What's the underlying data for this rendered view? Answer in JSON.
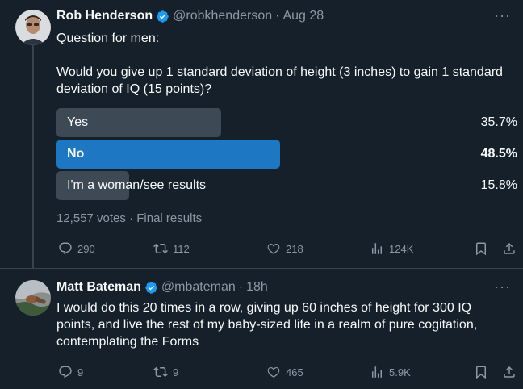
{
  "tweets": [
    {
      "display_name": "Rob Henderson",
      "handle": "@robkhenderson",
      "separator": "·",
      "time": "Aug 28",
      "text": "Question for men:\n\nWould you give up 1 standard deviation of height (3 inches) to gain 1 standard deviation of IQ (15 points)?",
      "poll": {
        "options": [
          {
            "label": "Yes",
            "percent": "35.7%",
            "fraction": 0.357,
            "winner": false
          },
          {
            "label": "No",
            "percent": "48.5%",
            "fraction": 0.485,
            "winner": true
          },
          {
            "label": "I'm a woman/see results",
            "percent": "15.8%",
            "fraction": 0.158,
            "winner": false
          }
        ],
        "votes": "12,557 votes",
        "meta_sep": "·",
        "status": "Final results"
      },
      "actions": {
        "replies": "290",
        "reposts": "112",
        "likes": "218",
        "views": "124K"
      }
    },
    {
      "display_name": "Matt Bateman",
      "handle": "@mbateman",
      "separator": "·",
      "time": "18h",
      "text": "I would do this 20 times in a row, giving up 60 inches of height for 300 IQ points, and live the rest of my baby-sized life in a realm of pure cogitation, contemplating the Forms",
      "actions": {
        "replies": "9",
        "reposts": "9",
        "likes": "465",
        "views": "5.9K"
      }
    }
  ],
  "colors": {
    "background": "#15202b",
    "text": "#f7f9f9",
    "secondary": "#8b98a5",
    "poll_bar": "#3d4a56",
    "poll_winner": "#1d77c2",
    "verified": "#1d9bf0"
  },
  "icons": [
    "verified-badge-icon",
    "more-icon",
    "reply-icon",
    "repost-icon",
    "like-icon",
    "views-icon",
    "bookmark-icon",
    "share-icon"
  ]
}
